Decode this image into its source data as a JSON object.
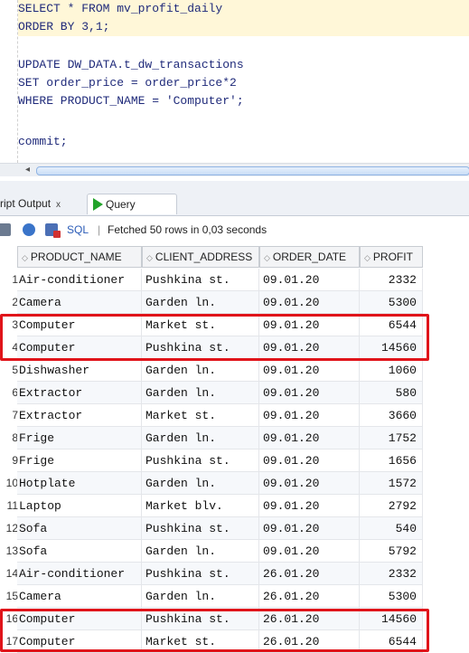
{
  "editor": {
    "lines": [
      "SELECT * FROM mv_profit_daily",
      "ORDER BY 3,1;",
      "",
      "UPDATE DW_DATA.t_dw_transactions",
      "SET order_price = order_price*2",
      "WHERE PRODUCT_NAME = 'Computer';",
      "",
      "commit;"
    ]
  },
  "tabs": {
    "script_output": "cript Output",
    "query_result": "Query Result",
    "close": "x"
  },
  "toolbar": {
    "sql_label": "SQL",
    "separator": "|",
    "fetched": "Fetched 50 rows in 0,03 seconds"
  },
  "grid": {
    "columns": [
      "PRODUCT_NAME",
      "CLIENT_ADDRESS",
      "ORDER_DATE",
      "PROFIT"
    ],
    "rows": [
      {
        "n": "1",
        "product": "Air-conditioner",
        "client": "Pushkina st.",
        "date": "09.01.20",
        "profit": "2332"
      },
      {
        "n": "2",
        "product": "Camera",
        "client": "Garden ln.",
        "date": "09.01.20",
        "profit": "5300"
      },
      {
        "n": "3",
        "product": "Computer",
        "client": "Market st.",
        "date": "09.01.20",
        "profit": "6544"
      },
      {
        "n": "4",
        "product": "Computer",
        "client": "Pushkina st.",
        "date": "09.01.20",
        "profit": "14560"
      },
      {
        "n": "5",
        "product": "Dishwasher",
        "client": "Garden ln.",
        "date": "09.01.20",
        "profit": "1060"
      },
      {
        "n": "6",
        "product": "Extractor",
        "client": "Garden ln.",
        "date": "09.01.20",
        "profit": "580"
      },
      {
        "n": "7",
        "product": "Extractor",
        "client": "Market st.",
        "date": "09.01.20",
        "profit": "3660"
      },
      {
        "n": "8",
        "product": "Frige",
        "client": "Garden ln.",
        "date": "09.01.20",
        "profit": "1752"
      },
      {
        "n": "9",
        "product": "Frige",
        "client": "Pushkina st.",
        "date": "09.01.20",
        "profit": "1656"
      },
      {
        "n": "10",
        "product": "Hotplate",
        "client": "Garden ln.",
        "date": "09.01.20",
        "profit": "1572"
      },
      {
        "n": "11",
        "product": "Laptop",
        "client": "Market blv.",
        "date": "09.01.20",
        "profit": "2792"
      },
      {
        "n": "12",
        "product": "Sofa",
        "client": "Pushkina st.",
        "date": "09.01.20",
        "profit": "540"
      },
      {
        "n": "13",
        "product": "Sofa",
        "client": "Garden ln.",
        "date": "09.01.20",
        "profit": "5792"
      },
      {
        "n": "14",
        "product": "Air-conditioner",
        "client": "Pushkina st.",
        "date": "26.01.20",
        "profit": "2332"
      },
      {
        "n": "15",
        "product": "Camera",
        "client": "Garden ln.",
        "date": "26.01.20",
        "profit": "5300"
      },
      {
        "n": "16",
        "product": "Computer",
        "client": "Pushkina st.",
        "date": "26.01.20",
        "profit": "14560"
      },
      {
        "n": "17",
        "product": "Computer",
        "client": "Market st.",
        "date": "26.01.20",
        "profit": "6544"
      }
    ]
  },
  "colors": {
    "highlight": "#e0141a",
    "run_icon": "#22a32a"
  }
}
